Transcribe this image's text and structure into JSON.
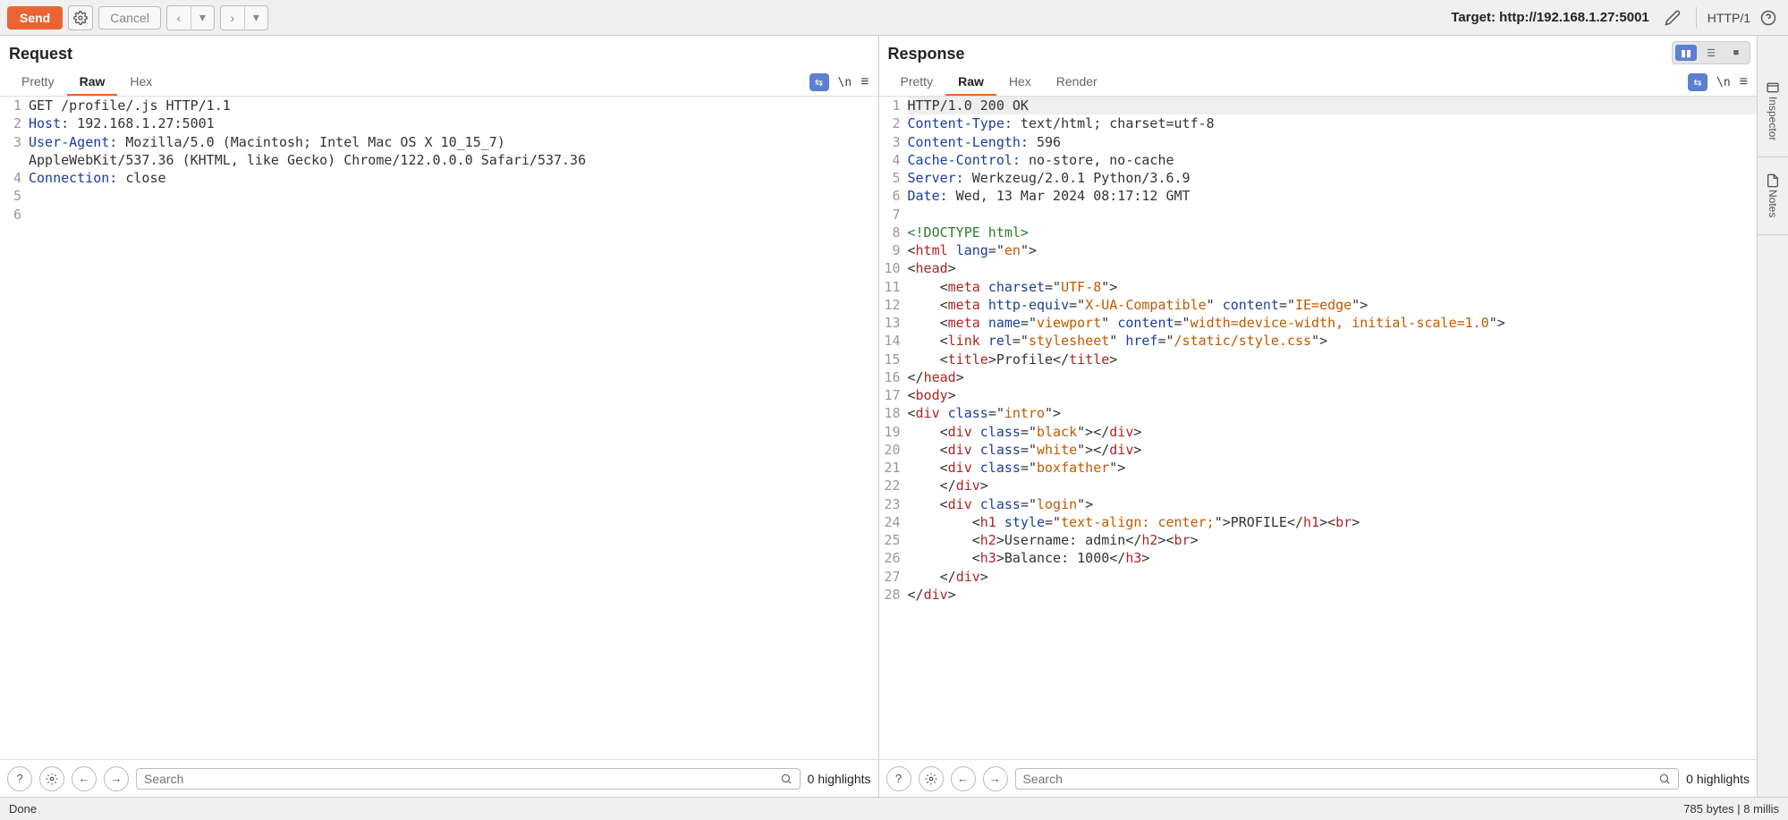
{
  "toolbar": {
    "send": "Send",
    "cancel": "Cancel",
    "target_prefix": "Target: ",
    "target": "http://192.168.1.27:5001",
    "http_version": "HTTP/1"
  },
  "layout_tooltip": "Layout",
  "request": {
    "title": "Request",
    "tabs": [
      "Pretty",
      "Raw",
      "Hex"
    ],
    "active_tab": "Raw",
    "slash_n": "\\n",
    "search_placeholder": "Search",
    "highlights": "0 highlights",
    "lines": [
      {
        "n": 1,
        "segs": [
          [
            "",
            "GET /profile/.js HTTP/1.1"
          ]
        ]
      },
      {
        "n": 2,
        "segs": [
          [
            "blue",
            "Host:"
          ],
          [
            "",
            " 192.168.1.27:5001"
          ]
        ]
      },
      {
        "n": 3,
        "segs": [
          [
            "blue",
            "User-Agent:"
          ],
          [
            "",
            " Mozilla/5.0 (Macintosh; Intel Mac OS X 10_15_7) "
          ]
        ]
      },
      {
        "n": "",
        "segs": [
          [
            "",
            "AppleWebKit/537.36 (KHTML, like Gecko) Chrome/122.0.0.0 Safari/537.36"
          ]
        ]
      },
      {
        "n": 4,
        "segs": [
          [
            "blue",
            "Connection:"
          ],
          [
            "",
            " close"
          ]
        ]
      },
      {
        "n": 5,
        "segs": [
          [
            "",
            ""
          ]
        ]
      },
      {
        "n": 6,
        "segs": [
          [
            "",
            ""
          ]
        ]
      }
    ]
  },
  "response": {
    "title": "Response",
    "tabs": [
      "Pretty",
      "Raw",
      "Hex",
      "Render"
    ],
    "active_tab": "Raw",
    "slash_n": "\\n",
    "search_placeholder": "Search",
    "highlights": "0 highlights",
    "lines": [
      {
        "n": 1,
        "hl": true,
        "segs": [
          [
            "",
            "HTTP/1.0 200 OK"
          ]
        ]
      },
      {
        "n": 2,
        "segs": [
          [
            "blue",
            "Content-Type:"
          ],
          [
            "",
            " text/html; charset=utf-8"
          ]
        ]
      },
      {
        "n": 3,
        "segs": [
          [
            "blue",
            "Content-Length:"
          ],
          [
            "",
            " 596"
          ]
        ]
      },
      {
        "n": 4,
        "segs": [
          [
            "blue",
            "Cache-Control:"
          ],
          [
            "",
            " no-store, no-cache"
          ]
        ]
      },
      {
        "n": 5,
        "segs": [
          [
            "blue",
            "Server:"
          ],
          [
            "",
            " Werkzeug/2.0.1 Python/3.6.9"
          ]
        ]
      },
      {
        "n": 6,
        "segs": [
          [
            "blue",
            "Date:"
          ],
          [
            "",
            " Wed, 13 Mar 2024 08:17:12 GMT"
          ]
        ]
      },
      {
        "n": 7,
        "segs": [
          [
            "",
            ""
          ]
        ]
      },
      {
        "n": 8,
        "segs": [
          [
            "green",
            "<!DOCTYPE html>"
          ]
        ]
      },
      {
        "n": 9,
        "segs": [
          [
            "",
            "<"
          ],
          [
            "red",
            "html"
          ],
          [
            "",
            " "
          ],
          [
            "blue",
            "lang"
          ],
          [
            "",
            "=\""
          ],
          [
            "orange",
            "en"
          ],
          [
            "",
            "\">"
          ]
        ]
      },
      {
        "n": 10,
        "segs": [
          [
            "",
            "<"
          ],
          [
            "red",
            "head"
          ],
          [
            "",
            ">"
          ]
        ]
      },
      {
        "n": 11,
        "segs": [
          [
            "",
            "    <"
          ],
          [
            "red",
            "meta"
          ],
          [
            "",
            " "
          ],
          [
            "blue",
            "charset"
          ],
          [
            "",
            "=\""
          ],
          [
            "orange",
            "UTF-8"
          ],
          [
            "",
            "\">"
          ]
        ]
      },
      {
        "n": 12,
        "segs": [
          [
            "",
            "    <"
          ],
          [
            "red",
            "meta"
          ],
          [
            "",
            " "
          ],
          [
            "blue",
            "http-equiv"
          ],
          [
            "",
            "=\""
          ],
          [
            "orange",
            "X-UA-Compatible"
          ],
          [
            "",
            "\" "
          ],
          [
            "blue",
            "content"
          ],
          [
            "",
            "=\""
          ],
          [
            "orange",
            "IE=edge"
          ],
          [
            "",
            "\">"
          ]
        ]
      },
      {
        "n": 13,
        "segs": [
          [
            "",
            "    <"
          ],
          [
            "red",
            "meta"
          ],
          [
            "",
            " "
          ],
          [
            "blue",
            "name"
          ],
          [
            "",
            "=\""
          ],
          [
            "orange",
            "viewport"
          ],
          [
            "",
            "\" "
          ],
          [
            "blue",
            "content"
          ],
          [
            "",
            "=\""
          ],
          [
            "orange",
            "width=device-width, initial-scale=1.0"
          ],
          [
            "",
            "\">"
          ]
        ]
      },
      {
        "n": 14,
        "segs": [
          [
            "",
            "    <"
          ],
          [
            "red",
            "link"
          ],
          [
            "",
            " "
          ],
          [
            "blue",
            "rel"
          ],
          [
            "",
            "=\""
          ],
          [
            "orange",
            "stylesheet"
          ],
          [
            "",
            "\" "
          ],
          [
            "blue",
            "href"
          ],
          [
            "",
            "=\""
          ],
          [
            "orange",
            "/static/style.css"
          ],
          [
            "",
            "\">"
          ]
        ]
      },
      {
        "n": 15,
        "segs": [
          [
            "",
            "    <"
          ],
          [
            "red",
            "title"
          ],
          [
            "",
            ">Profile</"
          ],
          [
            "red",
            "title"
          ],
          [
            "",
            ">"
          ]
        ]
      },
      {
        "n": 16,
        "segs": [
          [
            "",
            "</"
          ],
          [
            "red",
            "head"
          ],
          [
            "",
            ">"
          ]
        ]
      },
      {
        "n": 17,
        "segs": [
          [
            "",
            "<"
          ],
          [
            "red",
            "body"
          ],
          [
            "",
            ">"
          ]
        ]
      },
      {
        "n": 18,
        "segs": [
          [
            "",
            "<"
          ],
          [
            "red",
            "div"
          ],
          [
            "",
            " "
          ],
          [
            "blue",
            "class"
          ],
          [
            "",
            "=\""
          ],
          [
            "orange",
            "intro"
          ],
          [
            "",
            "\">"
          ]
        ]
      },
      {
        "n": 19,
        "segs": [
          [
            "",
            "    <"
          ],
          [
            "red",
            "div"
          ],
          [
            "",
            " "
          ],
          [
            "blue",
            "class"
          ],
          [
            "",
            "=\""
          ],
          [
            "orange",
            "black"
          ],
          [
            "",
            "\"></"
          ],
          [
            "red",
            "div"
          ],
          [
            "",
            ">"
          ]
        ]
      },
      {
        "n": 20,
        "segs": [
          [
            "",
            "    <"
          ],
          [
            "red",
            "div"
          ],
          [
            "",
            " "
          ],
          [
            "blue",
            "class"
          ],
          [
            "",
            "=\""
          ],
          [
            "orange",
            "white"
          ],
          [
            "",
            "\"></"
          ],
          [
            "red",
            "div"
          ],
          [
            "",
            ">"
          ]
        ]
      },
      {
        "n": 21,
        "segs": [
          [
            "",
            "    <"
          ],
          [
            "red",
            "div"
          ],
          [
            "",
            " "
          ],
          [
            "blue",
            "class"
          ],
          [
            "",
            "=\""
          ],
          [
            "orange",
            "boxfather"
          ],
          [
            "",
            "\">"
          ]
        ]
      },
      {
        "n": 22,
        "segs": [
          [
            "",
            "    </"
          ],
          [
            "red",
            "div"
          ],
          [
            "",
            ">"
          ]
        ]
      },
      {
        "n": 23,
        "segs": [
          [
            "",
            "    <"
          ],
          [
            "red",
            "div"
          ],
          [
            "",
            " "
          ],
          [
            "blue",
            "class"
          ],
          [
            "",
            "=\""
          ],
          [
            "orange",
            "login"
          ],
          [
            "",
            "\">"
          ]
        ]
      },
      {
        "n": 24,
        "segs": [
          [
            "",
            "        <"
          ],
          [
            "red",
            "h1"
          ],
          [
            "",
            " "
          ],
          [
            "blue",
            "style"
          ],
          [
            "",
            "=\""
          ],
          [
            "orange",
            "text-align: center;"
          ],
          [
            "",
            "\">PROFILE</"
          ],
          [
            "red",
            "h1"
          ],
          [
            "",
            "><"
          ],
          [
            "red",
            "br"
          ],
          [
            "",
            ">"
          ]
        ]
      },
      {
        "n": 25,
        "segs": [
          [
            "",
            "        <"
          ],
          [
            "red",
            "h2"
          ],
          [
            "",
            ">Username: admin</"
          ],
          [
            "red",
            "h2"
          ],
          [
            "",
            "><"
          ],
          [
            "red",
            "br"
          ],
          [
            "",
            ">"
          ]
        ]
      },
      {
        "n": 26,
        "segs": [
          [
            "",
            "        <"
          ],
          [
            "red",
            "h3"
          ],
          [
            "",
            ">Balance: 1000</"
          ],
          [
            "red",
            "h3"
          ],
          [
            "",
            ">"
          ]
        ]
      },
      {
        "n": 27,
        "segs": [
          [
            "",
            "    </"
          ],
          [
            "red",
            "div"
          ],
          [
            "",
            ">"
          ]
        ]
      },
      {
        "n": 28,
        "segs": [
          [
            "",
            "</"
          ],
          [
            "red",
            "div"
          ],
          [
            "",
            ">"
          ]
        ]
      }
    ]
  },
  "right_rail": {
    "inspector": "Inspector",
    "notes": "Notes"
  },
  "status": {
    "left": "Done",
    "right": "785 bytes | 8 millis"
  }
}
